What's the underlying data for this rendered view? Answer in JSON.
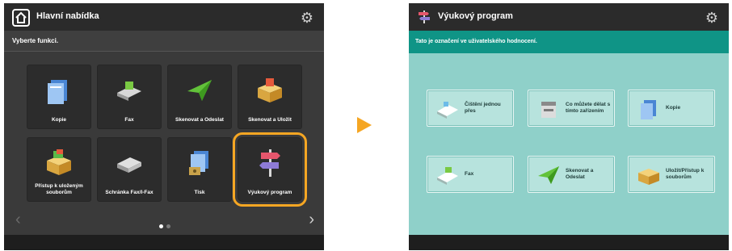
{
  "left_screen": {
    "title": "Hlavní nabídka",
    "subtitle": "Vyberte funkci.",
    "tiles": [
      {
        "label": "Kopie",
        "icon": "copy-icon"
      },
      {
        "label": "Fax",
        "icon": "fax-icon"
      },
      {
        "label": "Skenovat a Odeslat",
        "icon": "scan-send-icon"
      },
      {
        "label": "Skenovat a Uložit",
        "icon": "scan-store-icon"
      },
      {
        "label": "Přístup k uloženým souborům",
        "icon": "stored-files-icon"
      },
      {
        "label": "Schránka Fax/I-Fax",
        "icon": "fax-inbox-icon"
      },
      {
        "label": "Tisk",
        "icon": "print-icon"
      },
      {
        "label": "Výukový program",
        "icon": "signpost-icon"
      }
    ],
    "pager": {
      "current": 1,
      "total": 2
    }
  },
  "right_screen": {
    "title": "Výukový program",
    "subtitle": "Tato je označení ve uživatelského hodnocení.",
    "buttons": [
      {
        "label": "Čištění jednou přes",
        "icon": "cleaning-icon"
      },
      {
        "label": "Co můžete dělat s tímto zařízením",
        "icon": "device-icon"
      },
      {
        "label": "Kopie",
        "icon": "copy-icon"
      },
      {
        "label": "Fax",
        "icon": "fax-icon"
      },
      {
        "label": "Skenovat a Odeslat",
        "icon": "scan-send-icon"
      },
      {
        "label": "Uložit/Přístup k souborům",
        "icon": "storage-icon"
      }
    ]
  },
  "colors": {
    "left_bg": "#3a3a3a",
    "topbar": "#2b2b2b",
    "accent_orange": "#f5a623",
    "right_bg": "#8fd0c9",
    "right_subbar": "#0f9486",
    "button_bg": "#b7e3dd"
  }
}
